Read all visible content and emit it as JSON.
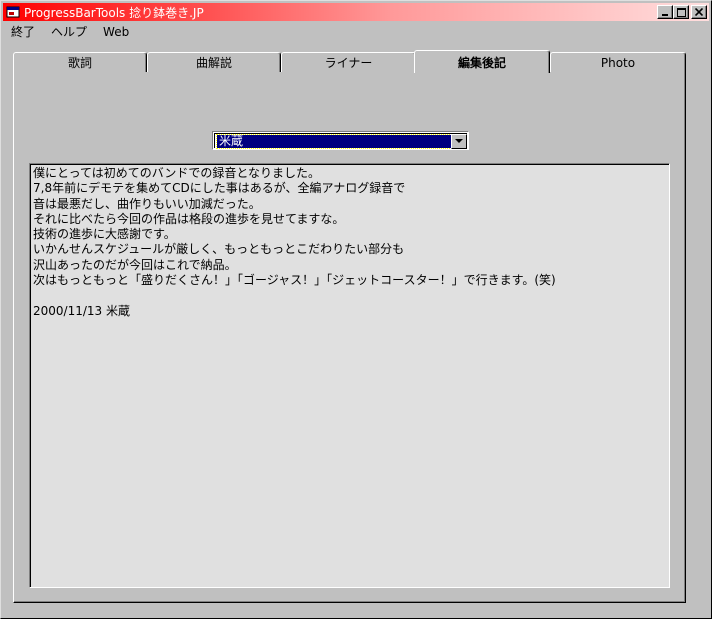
{
  "window": {
    "title": "ProgressBarTools  捻り鉢巻き.JP"
  },
  "menu": [
    "終了",
    "ヘルプ",
    "Web"
  ],
  "tabs": [
    {
      "label": "歌詞"
    },
    {
      "label": "曲解説"
    },
    {
      "label": "ライナー"
    },
    {
      "label": "編集後記"
    },
    {
      "label": "Photo"
    }
  ],
  "active_tab": "編集後記",
  "selector": {
    "value": "米蔵"
  },
  "content": {
    "text": "僕にとっては初めてのバンドでの録音となりました。\n7,8年前にデモテを集めてCDにした事はあるが、全編アナログ録音で\n音は最悪だし、曲作りもいい加減だった。\nそれに比べたら今回の作品は格段の進歩を見せてますな。\n技術の進歩に大感謝です。\nいかんせんスケジュールが厳しく、もっともっとこだわりたい部分も\n沢山あったのだが今回はこれで納品。\n次はもっともっと「盛りだくさん！」「ゴージャス！」「ジェットコースター！」で行きます。(笑)\n\n2000/11/13 米蔵"
  },
  "colors": {
    "titlebar_start": "#ff0000",
    "titlebar_end": "#ffdede",
    "selection": "#000080",
    "face": "#c0c0c0",
    "text_bg": "#e0e0e0"
  },
  "icons": {
    "app": "app-window-icon",
    "minimize": "minimize-icon",
    "maximize": "maximize-icon",
    "close": "close-icon",
    "dropdown": "chevron-down-icon"
  }
}
